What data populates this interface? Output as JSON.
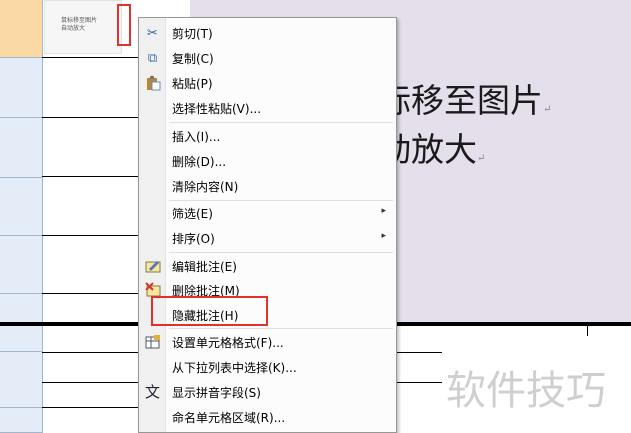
{
  "thumbnail": {
    "line1": "鼠标移至图片",
    "line2": "自动放大"
  },
  "comment": {
    "line1": "标移至图片",
    "line2": "动放大",
    "return_mark": "↵"
  },
  "context_menu": {
    "items": [
      {
        "label": "剪切(T)",
        "icon": "scissors-icon",
        "glyph": "✂"
      },
      {
        "label": "复制(C)",
        "icon": "copy-icon",
        "glyph": "⧉"
      },
      {
        "label": "粘贴(P)",
        "icon": "paste-icon",
        "glyph": "📋"
      },
      {
        "label": "选择性粘贴(V)...",
        "icon": "",
        "glyph": ""
      },
      {
        "label": "插入(I)...",
        "icon": "",
        "glyph": ""
      },
      {
        "label": "删除(D)...",
        "icon": "",
        "glyph": ""
      },
      {
        "label": "清除内容(N)",
        "icon": "",
        "glyph": ""
      },
      {
        "label": "筛选(E)",
        "icon": "",
        "glyph": "",
        "submenu": true
      },
      {
        "label": "排序(O)",
        "icon": "",
        "glyph": "",
        "submenu": true
      },
      {
        "label": "编辑批注(E)",
        "icon": "edit-comment-icon",
        "glyph": "✎"
      },
      {
        "label": "删除批注(M)",
        "icon": "delete-comment-icon",
        "glyph": "✖"
      },
      {
        "label": "隐藏批注(H)",
        "icon": "",
        "glyph": ""
      },
      {
        "label": "设置单元格格式(F)...",
        "icon": "format-cells-icon",
        "glyph": "▦"
      },
      {
        "label": "从下拉列表中选择(K)...",
        "icon": "",
        "glyph": ""
      },
      {
        "label": "显示拼音字段(S)",
        "icon": "pinyin-icon",
        "glyph": "文"
      },
      {
        "label": "命名单元格区域(R)...",
        "icon": "",
        "glyph": ""
      }
    ],
    "arrow_glyph": "▸"
  },
  "watermark": "软件技巧"
}
